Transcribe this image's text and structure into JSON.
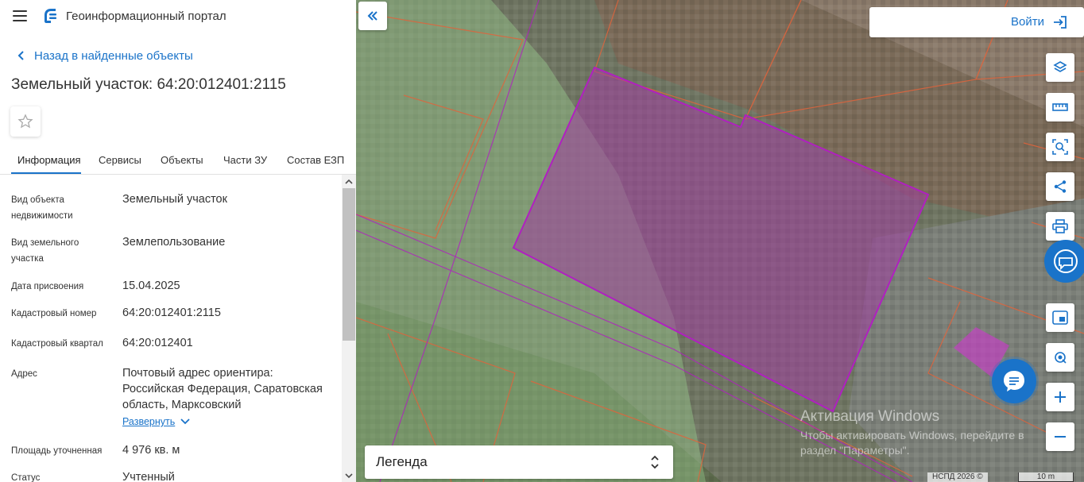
{
  "header": {
    "portal_title": "Геоинформационный портал"
  },
  "nav": {
    "back_label": "Назад в найденные объекты"
  },
  "object": {
    "title": "Земельный участок: 64:20:012401:2115"
  },
  "tabs": [
    {
      "label": "Информация"
    },
    {
      "label": "Сервисы"
    },
    {
      "label": "Объекты"
    },
    {
      "label": "Части ЗУ"
    },
    {
      "label": "Состав ЕЗП"
    }
  ],
  "info": {
    "rows": [
      {
        "label": "Вид объекта недвижимости",
        "value": "Земельный участок"
      },
      {
        "label": "Вид земельного участка",
        "value": "Землепользование"
      },
      {
        "label": "Дата присвоения",
        "value": "15.04.2025"
      },
      {
        "label": "Кадастровый номер",
        "value": "64:20:012401:2115"
      },
      {
        "label": "Кадастровый квартал",
        "value": "64:20:012401"
      },
      {
        "label": "Адрес",
        "value": "Почтовый адрес ориентира: Российская Федерация, Саратовская область, Марксовский"
      },
      {
        "label": "Площадь уточненная",
        "value": "4 976 кв. м"
      },
      {
        "label": "Статус",
        "value": "Учтенный"
      }
    ],
    "expand_label": "Развернуть"
  },
  "map": {
    "login_label": "Войти",
    "legend_label": "Легенда",
    "watermark_title": "Активация Windows",
    "watermark_text": "Чтобы активировать Windows, перейдите в раздел \"Параметры\".",
    "attribution": "НСПД 2026 ©",
    "scale_label": "10 m"
  },
  "icons": {
    "tools": [
      "layers-icon",
      "ruler-icon",
      "area-search-icon",
      "share-icon",
      "print-icon",
      "picture-in-picture-icon",
      "geolocation-icon",
      "zoom-in-icon",
      "zoom-out-icon"
    ]
  },
  "colors": {
    "accent": "#1a73c9",
    "parcel_fill": "#a03ca0",
    "parcel_border": "#b020c0",
    "boundary": "#e0643c"
  }
}
